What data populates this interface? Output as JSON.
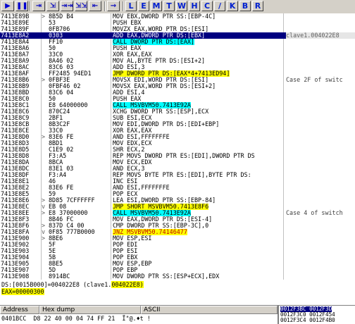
{
  "toolbar": {
    "buttons": [
      "▶",
      "❚❚",
      "⇥",
      "⇲",
      "⇥⇥",
      "⇲⇲",
      "⇤",
      "→"
    ],
    "letters": [
      "L",
      "E",
      "M",
      "T",
      "W",
      "H",
      "C",
      "/",
      "K",
      "B",
      "R"
    ]
  },
  "disasm": {
    "rows": [
      {
        "addr": "7413E89B",
        "ind": ">",
        "hex": "8B5D B4",
        "cmd": "MOV EBX,DWORD PTR SS:[EBP-4C]"
      },
      {
        "addr": "7413E89E",
        "ind": "",
        "hex": "53",
        "cmd": "PUSH EBX"
      },
      {
        "addr": "7413E89F",
        "ind": "",
        "hex": "0FB706",
        "cmd": "MOVZX EAX,WORD PTR DS:[ESI]"
      },
      {
        "addr": "7413E8A2",
        "ind": "",
        "hex": "0303",
        "cmd": "ADD EAX,DWORD PTR DS:[EBX]",
        "cmt": "clave1.004022E8"
      },
      {
        "addr": "7413E8A4",
        "ind": "",
        "hex": "FF10",
        "cmd": "CALL DWORD PTR DS:[EAX]"
      },
      {
        "addr": "7413E8A6",
        "ind": "",
        "hex": "50",
        "cmd": "PUSH EAX"
      },
      {
        "addr": "7413E8A7",
        "ind": "",
        "hex": "33C0",
        "cmd": "XOR EAX,EAX"
      },
      {
        "addr": "7413E8A9",
        "ind": "",
        "hex": "8A46 02",
        "cmd": "MOV AL,BYTE PTR DS:[ESI+2]"
      },
      {
        "addr": "7413E8AC",
        "ind": "",
        "hex": "83C6 03",
        "cmd": "ADD ESI,3"
      },
      {
        "addr": "7413E8AF",
        "ind": "",
        "hex": "FF2485 94ED1",
        "cmd": "JMP DWORD PTR DS:[EAX*4+7413ED94]"
      },
      {
        "addr": "7413E8B6",
        "ind": ">",
        "hex": "0FBF3E",
        "cmd": "MOVSX EDI,WORD PTR DS:[ESI]",
        "cmt": "Case 2F of switc"
      },
      {
        "addr": "7413E8B9",
        "ind": "",
        "hex": "0FBF46 02",
        "cmd": "MOVSX EAX,WORD PTR DS:[ESI+2]"
      },
      {
        "addr": "7413E8BD",
        "ind": "",
        "hex": "83C6 04",
        "cmd": "ADD ESI,4"
      },
      {
        "addr": "7413E8C0",
        "ind": "",
        "hex": "50",
        "cmd": "PUSH EAX"
      },
      {
        "addr": "7413E8C1",
        "ind": "",
        "hex": "E8 64000000",
        "cmd": "CALL MSVBVM50.7413E92A"
      },
      {
        "addr": "7413E8C6",
        "ind": "",
        "hex": "870C24",
        "cmd": "XCHG DWORD PTR SS:[ESP],ECX"
      },
      {
        "addr": "7413E8C9",
        "ind": "",
        "hex": "2BF1",
        "cmd": "SUB ESI,ECX"
      },
      {
        "addr": "7413E8CB",
        "ind": "",
        "hex": "8B3C2F",
        "cmd": "MOV EDI,DWORD PTR DS:[EDI+EBP]"
      },
      {
        "addr": "7413E8CE",
        "ind": "",
        "hex": "33C0",
        "cmd": "XOR EAX,EAX"
      },
      {
        "addr": "7413E8D0",
        "ind": ">",
        "hex": "83E6 FE",
        "cmd": "AND ESI,FFFFFFFE"
      },
      {
        "addr": "7413E8D3",
        "ind": "",
        "hex": "8BD1",
        "cmd": "MOV EDX,ECX"
      },
      {
        "addr": "7413E8D5",
        "ind": "",
        "hex": "C1E9 02",
        "cmd": "SHR ECX,2"
      },
      {
        "addr": "7413E8D8",
        "ind": "",
        "hex": "F3:A5",
        "cmd": "REP MOVS DWORD PTR ES:[EDI],DWORD PTR DS"
      },
      {
        "addr": "7413E8DA",
        "ind": "",
        "hex": "8BCA",
        "cmd": "MOV ECX,EDX"
      },
      {
        "addr": "7413E8DC",
        "ind": "",
        "hex": "83E1 03",
        "cmd": "AND ECX,3"
      },
      {
        "addr": "7413E8DF",
        "ind": "",
        "hex": "F3:A4",
        "cmd": "REP MOVS BYTE PTR ES:[EDI],BYTE PTR DS:"
      },
      {
        "addr": "7413E8E1",
        "ind": "",
        "hex": "46",
        "cmd": "INC ESI"
      },
      {
        "addr": "7413E8E2",
        "ind": "",
        "hex": "83E6 FE",
        "cmd": "AND ESI,FFFFFFFE"
      },
      {
        "addr": "7413E8E5",
        "ind": "",
        "hex": "59",
        "cmd": "POP ECX"
      },
      {
        "addr": "7413E8E6",
        "ind": ">",
        "hex": "8D85 7CFFFFFF",
        "cmd": "LEA ESI,DWORD PTR SS:[EBP-84]"
      },
      {
        "addr": "7413E8EC",
        "ind": "v",
        "hex": "EB 08",
        "cmd": "JMP SHORT MSVBVM50.7413E8F6"
      },
      {
        "addr": "7413E8EE",
        "ind": ">",
        "hex": "E8 37000000",
        "cmd": "CALL MSVBVM50.7413E92A",
        "cmt": "Case 4 of switch"
      },
      {
        "addr": "7413E8F3",
        "ind": "",
        "hex": "8B46 FC",
        "cmd": "MOV EAX,DWORD PTR DS:[ESI-4]"
      },
      {
        "addr": "7413E8F6",
        "ind": ">",
        "hex": "837D C4 00",
        "cmd": "CMP DWORD PTR SS:[EBP-3C],0"
      },
      {
        "addr": "7413E8FA",
        "ind": "v",
        "hex": "0F85 777B0000",
        "cmd": "JNZ MSVBVM50.74146477"
      },
      {
        "addr": "7413E900",
        "ind": ">",
        "hex": "8BE6",
        "cmd": "MOV ESP,ESI"
      },
      {
        "addr": "7413E902",
        "ind": "",
        "hex": "5F",
        "cmd": "POP EDI"
      },
      {
        "addr": "7413E903",
        "ind": "",
        "hex": "5E",
        "cmd": "POP ESI"
      },
      {
        "addr": "7413E904",
        "ind": "",
        "hex": "5B",
        "cmd": "POP EBX"
      },
      {
        "addr": "7413E905",
        "ind": "",
        "hex": "8BE5",
        "cmd": "MOV ESP,EBP"
      },
      {
        "addr": "7413E907",
        "ind": "",
        "hex": "5D",
        "cmd": "POP EBP"
      },
      {
        "addr": "7413E908",
        "ind": "",
        "hex": "8914BC",
        "cmd": "MOV DWORD PTR SS:[ESP+ECX],EDX"
      }
    ]
  },
  "info": {
    "line1_pre": "DS:[0015B000]=004022E8 (clave1.",
    "line1_hl": "004022E8)",
    "line2": "EAX=00000300"
  },
  "dump": {
    "col_address": "Address",
    "col_hex": "Hex dump",
    "col_ascii": "ASCII",
    "line": "0401BCC  D8 22 40 00 04 74 FF 21  Ï\"@.♦t !"
  },
  "stack": {
    "rows": [
      "0012F3BC 0012F3D",
      "0012F3C0 0012F454",
      "0012F3C4 0012F4B0"
    ]
  }
}
